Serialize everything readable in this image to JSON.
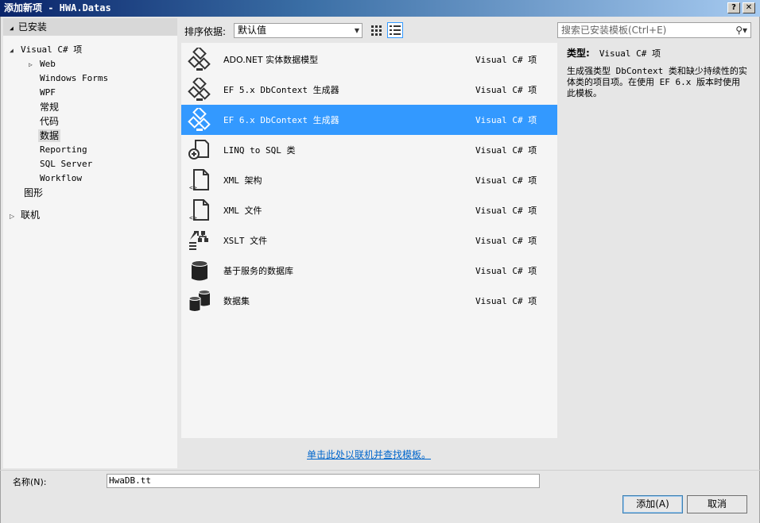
{
  "window": {
    "title": "添加新项 - HWA.Datas",
    "help_btn": "?",
    "close_btn": "✕"
  },
  "tree": {
    "header": "已安装",
    "nodes": [
      {
        "label": "Visual C# 项",
        "arrow": "◢"
      },
      {
        "label": "Web",
        "arrow": "▷"
      },
      {
        "label": "Windows Forms",
        "arrow": ""
      },
      {
        "label": "WPF",
        "arrow": ""
      },
      {
        "label": "常规",
        "arrow": ""
      },
      {
        "label": "代码",
        "arrow": ""
      },
      {
        "label": "数据",
        "arrow": ""
      },
      {
        "label": "Reporting",
        "arrow": ""
      },
      {
        "label": "SQL Server",
        "arrow": ""
      },
      {
        "label": "Workflow",
        "arrow": ""
      },
      {
        "label": "图形",
        "arrow": ""
      },
      {
        "label": "联机",
        "arrow": "▷"
      }
    ]
  },
  "toolbar": {
    "sort_label": "排序依据:",
    "sort_value": "默认值"
  },
  "search": {
    "placeholder": "搜索已安装模板(Ctrl+E)"
  },
  "items": [
    {
      "name": "ADO.NET 实体数据模型",
      "type": "Visual C# 项",
      "icon": "ef-diagram-icon"
    },
    {
      "name": "EF 5.x DbContext 生成器",
      "type": "Visual C# 项",
      "icon": "ef-diagram-icon"
    },
    {
      "name": "EF 6.x DbContext 生成器",
      "type": "Visual C# 项",
      "icon": "ef-diagram-icon"
    },
    {
      "name": "LINQ to SQL 类",
      "type": "Visual C# 项",
      "icon": "linq-icon"
    },
    {
      "name": "XML 架构",
      "type": "Visual C# 项",
      "icon": "xml-file-icon"
    },
    {
      "name": "XML 文件",
      "type": "Visual C# 项",
      "icon": "xml-file-icon"
    },
    {
      "name": "XSLT 文件",
      "type": "Visual C# 项",
      "icon": "xslt-icon"
    },
    {
      "name": "基于服务的数据库",
      "type": "Visual C# 项",
      "icon": "database-icon"
    },
    {
      "name": "数据集",
      "type": "Visual C# 项",
      "icon": "dataset-icon"
    }
  ],
  "selected_item": "EF 6.x DbContext 生成器",
  "description": {
    "type_label": "类型:",
    "type_value": "Visual C# 项",
    "text": "生成强类型 DbContext 类和缺少持续性的实体类的项目项。在使用 EF 6.x 版本时使用此模板。"
  },
  "online_link": "单击此处以联机并查找模板。",
  "name_field": {
    "label": "名称(N):",
    "value": "HwaDB.tt"
  },
  "buttons": {
    "add": "添加(A)",
    "cancel": "取消"
  },
  "colors": {
    "selection": "#3399ff",
    "link": "#0066cc"
  }
}
